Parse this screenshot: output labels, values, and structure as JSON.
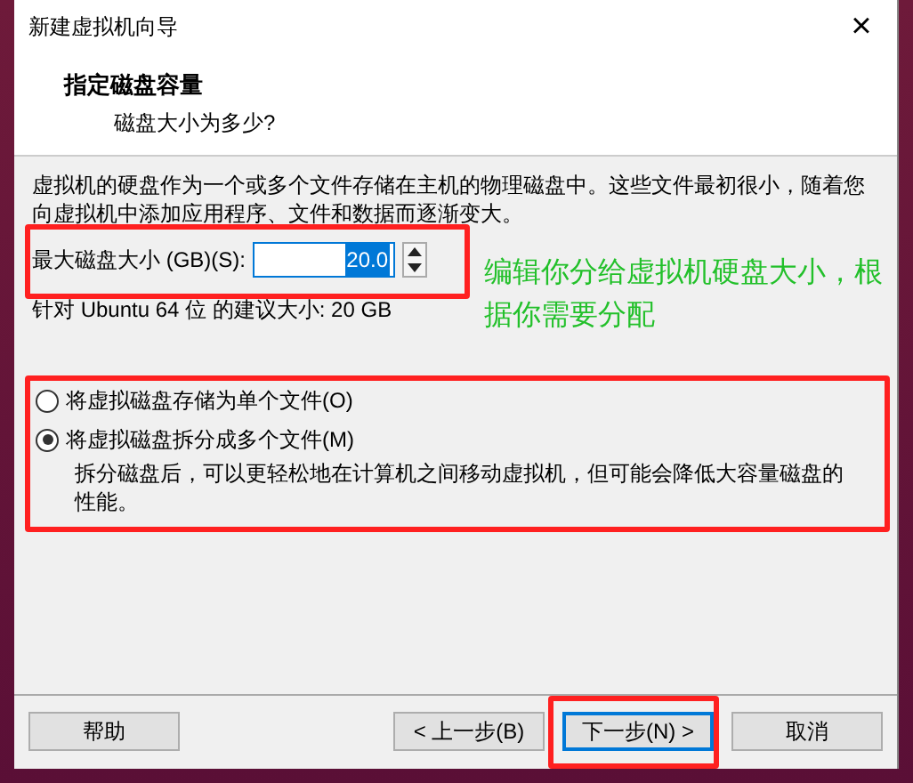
{
  "window": {
    "title": "新建虚拟机向导",
    "close": "×"
  },
  "header": {
    "title": "指定磁盘容量",
    "subtitle": "磁盘大小为多少?"
  },
  "description": "虚拟机的硬盘作为一个或多个文件存储在主机的物理磁盘中。这些文件最初很小，随着您向虚拟机中添加应用程序、文件和数据而逐渐变大。",
  "disk_size": {
    "label": "最大磁盘大小 (GB)(S):",
    "value": "20.0",
    "recommendation": "针对 Ubuntu 64 位 的建议大小: 20 GB"
  },
  "annotations": [
    {
      "kind": "note",
      "text": "编辑你分给虚拟机硬盘大小，根据你需要分配"
    }
  ],
  "storage_options": [
    {
      "label": "将虚拟磁盘存储为单个文件(O)",
      "selected": false
    },
    {
      "label": "将虚拟磁盘拆分成多个文件(M)",
      "selected": true,
      "note": "拆分磁盘后，可以更轻松地在计算机之间移动虚拟机，但可能会降低大容量磁盘的性能。"
    }
  ],
  "buttons": [
    {
      "label": "帮助",
      "kind": "help",
      "default": false
    },
    {
      "label": "< 上一步(B)",
      "kind": "nav",
      "default": false
    },
    {
      "label": "下一步(N) >",
      "kind": "nav",
      "default": true
    },
    {
      "label": "取消",
      "kind": "nav",
      "default": false
    }
  ]
}
